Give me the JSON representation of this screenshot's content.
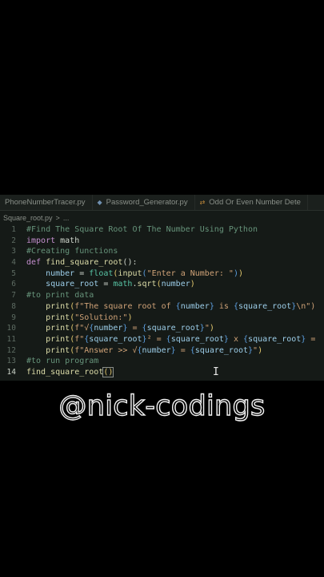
{
  "tabs": [
    {
      "label": "PhoneNumberTracer.py",
      "icon": "none"
    },
    {
      "label": "Password_Generator.py",
      "icon": "python-diamond-icon"
    },
    {
      "label": "Odd Or Even Number Dete",
      "icon": "git-compare-icon"
    }
  ],
  "breadcrumb": {
    "file": "Square_root.py",
    "separator": ">",
    "ellipsis": "..."
  },
  "code_lines": [
    {
      "num": "1",
      "segments": [
        {
          "t": "#Find The Square Root Of The Number Using Python",
          "c": "comment"
        }
      ]
    },
    {
      "num": "2",
      "segments": [
        {
          "t": "import",
          "c": "kw"
        },
        {
          "t": " math",
          "c": "plain"
        }
      ]
    },
    {
      "num": "3",
      "segments": [
        {
          "t": "#Creating functions",
          "c": "comment"
        }
      ]
    },
    {
      "num": "4",
      "segments": [
        {
          "t": "def ",
          "c": "kw"
        },
        {
          "t": "find_square_root",
          "c": "fn"
        },
        {
          "t": "():",
          "c": "plain"
        }
      ]
    },
    {
      "num": "5",
      "segments": [
        {
          "t": "    number",
          "c": "var"
        },
        {
          "t": " = ",
          "c": "plain"
        },
        {
          "t": "float",
          "c": "mod"
        },
        {
          "t": "(",
          "c": "br2"
        },
        {
          "t": "input",
          "c": "fn"
        },
        {
          "t": "(",
          "c": "brace"
        },
        {
          "t": "\"Enter a Number: \"",
          "c": "str"
        },
        {
          "t": ")",
          "c": "brace"
        },
        {
          "t": ")",
          "c": "br2"
        }
      ]
    },
    {
      "num": "6",
      "segments": [
        {
          "t": "    square_root",
          "c": "var"
        },
        {
          "t": " = ",
          "c": "plain"
        },
        {
          "t": "math",
          "c": "mod"
        },
        {
          "t": ".",
          "c": "plain"
        },
        {
          "t": "sqrt",
          "c": "fn"
        },
        {
          "t": "(",
          "c": "br2"
        },
        {
          "t": "number",
          "c": "var"
        },
        {
          "t": ")",
          "c": "br2"
        }
      ]
    },
    {
      "num": "7",
      "segments": [
        {
          "t": "#to print data",
          "c": "comment"
        }
      ]
    },
    {
      "num": "8",
      "segments": [
        {
          "t": "    print",
          "c": "fn"
        },
        {
          "t": "(",
          "c": "br2"
        },
        {
          "t": "f\"The square root of ",
          "c": "str"
        },
        {
          "t": "{",
          "c": "brace"
        },
        {
          "t": "number",
          "c": "var"
        },
        {
          "t": "}",
          "c": "brace"
        },
        {
          "t": " is ",
          "c": "str"
        },
        {
          "t": "{",
          "c": "brace"
        },
        {
          "t": "square_root",
          "c": "var"
        },
        {
          "t": "}",
          "c": "brace"
        },
        {
          "t": "\\n\")",
          "c": "str"
        }
      ]
    },
    {
      "num": "9",
      "segments": [
        {
          "t": "    print",
          "c": "fn"
        },
        {
          "t": "(",
          "c": "br2"
        },
        {
          "t": "\"Solution:\"",
          "c": "str"
        },
        {
          "t": ")",
          "c": "br2"
        }
      ]
    },
    {
      "num": "10",
      "segments": [
        {
          "t": "    print",
          "c": "fn"
        },
        {
          "t": "(",
          "c": "br2"
        },
        {
          "t": "f\"√",
          "c": "str"
        },
        {
          "t": "{",
          "c": "brace"
        },
        {
          "t": "number",
          "c": "var"
        },
        {
          "t": "}",
          "c": "brace"
        },
        {
          "t": " = ",
          "c": "str"
        },
        {
          "t": "{",
          "c": "brace"
        },
        {
          "t": "square_root",
          "c": "var"
        },
        {
          "t": "}",
          "c": "brace"
        },
        {
          "t": "\"",
          "c": "str"
        },
        {
          "t": ")",
          "c": "br2"
        }
      ]
    },
    {
      "num": "11",
      "segments": [
        {
          "t": "    print",
          "c": "fn"
        },
        {
          "t": "(",
          "c": "br2"
        },
        {
          "t": "f\"",
          "c": "str"
        },
        {
          "t": "{",
          "c": "brace"
        },
        {
          "t": "square_root",
          "c": "var"
        },
        {
          "t": "}",
          "c": "brace"
        },
        {
          "t": "² = ",
          "c": "str"
        },
        {
          "t": "{",
          "c": "brace"
        },
        {
          "t": "square_root",
          "c": "var"
        },
        {
          "t": "}",
          "c": "brace"
        },
        {
          "t": " x ",
          "c": "str"
        },
        {
          "t": "{",
          "c": "brace"
        },
        {
          "t": "square_root",
          "c": "var"
        },
        {
          "t": "}",
          "c": "brace"
        },
        {
          "t": " = ",
          "c": "str"
        }
      ]
    },
    {
      "num": "12",
      "segments": [
        {
          "t": "    print",
          "c": "fn"
        },
        {
          "t": "(",
          "c": "br2"
        },
        {
          "t": "f\"Answer >> √",
          "c": "str"
        },
        {
          "t": "{",
          "c": "brace"
        },
        {
          "t": "number",
          "c": "var"
        },
        {
          "t": "}",
          "c": "brace"
        },
        {
          "t": " = ",
          "c": "str"
        },
        {
          "t": "{",
          "c": "brace"
        },
        {
          "t": "square_root",
          "c": "var"
        },
        {
          "t": "}",
          "c": "brace"
        },
        {
          "t": "\"",
          "c": "str"
        },
        {
          "t": ")",
          "c": "br2"
        }
      ]
    },
    {
      "num": "13",
      "segments": [
        {
          "t": "#to run program",
          "c": "comment"
        }
      ]
    },
    {
      "num": "14",
      "segments": [
        {
          "t": "find_square_root",
          "c": "fn"
        },
        {
          "t": "()",
          "c": "br2",
          "box": true
        }
      ]
    }
  ],
  "active_line": "14",
  "watermark": "@nick-codings"
}
